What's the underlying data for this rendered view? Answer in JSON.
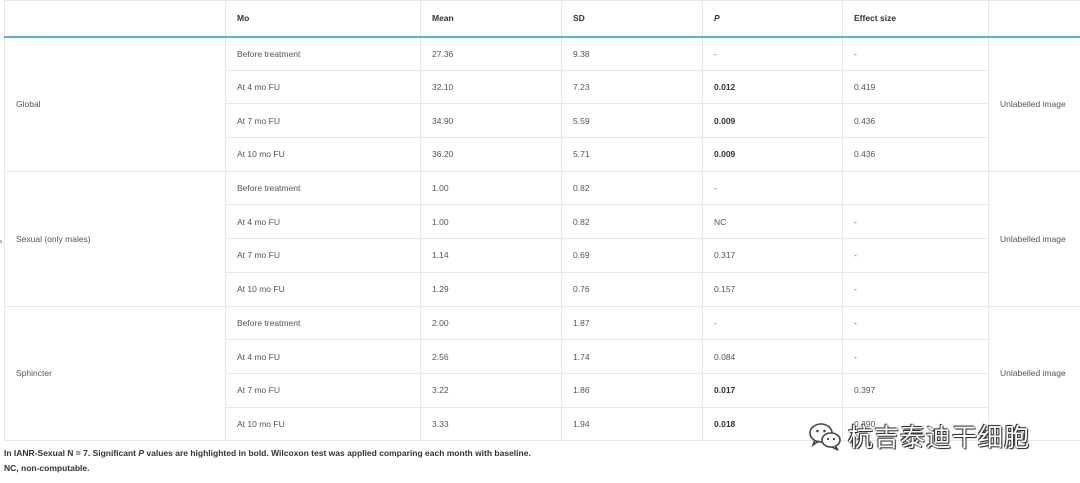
{
  "table": {
    "headers": [
      "",
      "Mo",
      "Mean",
      "SD",
      "P",
      "Effect size",
      ""
    ],
    "groups": [
      {
        "label": "Global",
        "image": "Unlabelled image",
        "rows": [
          {
            "mo": "Before treatment",
            "mean": "27.36",
            "sd": "9.38",
            "p": "-",
            "p_bold": false,
            "effect": "-"
          },
          {
            "mo": "At 4 mo FU",
            "mean": "32.10",
            "sd": "7.23",
            "p": "0.012",
            "p_bold": true,
            "effect": "0.419"
          },
          {
            "mo": "At 7 mo FU",
            "mean": "34.90",
            "sd": "5.59",
            "p": "0.009",
            "p_bold": true,
            "effect": "0.436"
          },
          {
            "mo": "At 10 mo FU",
            "mean": "36.20",
            "sd": "5.71",
            "p": "0.009",
            "p_bold": true,
            "effect": "0.436"
          }
        ]
      },
      {
        "label": "Sexual (only males)",
        "image": "Unlabelled image",
        "rows": [
          {
            "mo": "Before treatment",
            "mean": "1.00",
            "sd": "0.82",
            "p": "-",
            "p_bold": false,
            "effect": ""
          },
          {
            "mo": "At 4 mo FU",
            "mean": "1.00",
            "sd": "0.82",
            "p": "NC",
            "p_bold": false,
            "effect": "-"
          },
          {
            "mo": "At 7 mo FU",
            "mean": "1.14",
            "sd": "0.69",
            "p": "0.317",
            "p_bold": false,
            "effect": "-"
          },
          {
            "mo": "At 10 mo FU",
            "mean": "1.29",
            "sd": "0.76",
            "p": "0.157",
            "p_bold": false,
            "effect": "-"
          }
        ]
      },
      {
        "label": "Sphincter",
        "image": "Unlabelled image",
        "rows": [
          {
            "mo": "Before treatment",
            "mean": "2.00",
            "sd": "1.87",
            "p": "-",
            "p_bold": false,
            "effect": "-"
          },
          {
            "mo": "At 4 mo FU",
            "mean": "2.56",
            "sd": "1.74",
            "p": "0.084",
            "p_bold": false,
            "effect": "-"
          },
          {
            "mo": "At 7 mo FU",
            "mean": "3.22",
            "sd": "1.86",
            "p": "0.017",
            "p_bold": true,
            "effect": "0.397"
          },
          {
            "mo": "At 10 mo FU",
            "mean": "3.33",
            "sd": "1.94",
            "p": "0.018",
            "p_bold": true,
            "effect": "0.390"
          }
        ]
      }
    ]
  },
  "notes": {
    "line1_a": "In IANR-Sexual N = 7. Significant ",
    "line1_p": "P",
    "line1_b": " values are highlighted in ",
    "line1_bold": "bold",
    "line1_c": ". Wilcoxon test was applied comparing each month with baseline.",
    "line2": "NC, non-computable."
  },
  "watermark": {
    "text": "杭吉泰迪干细胞",
    "icon": "wechat-logo-icon"
  }
}
